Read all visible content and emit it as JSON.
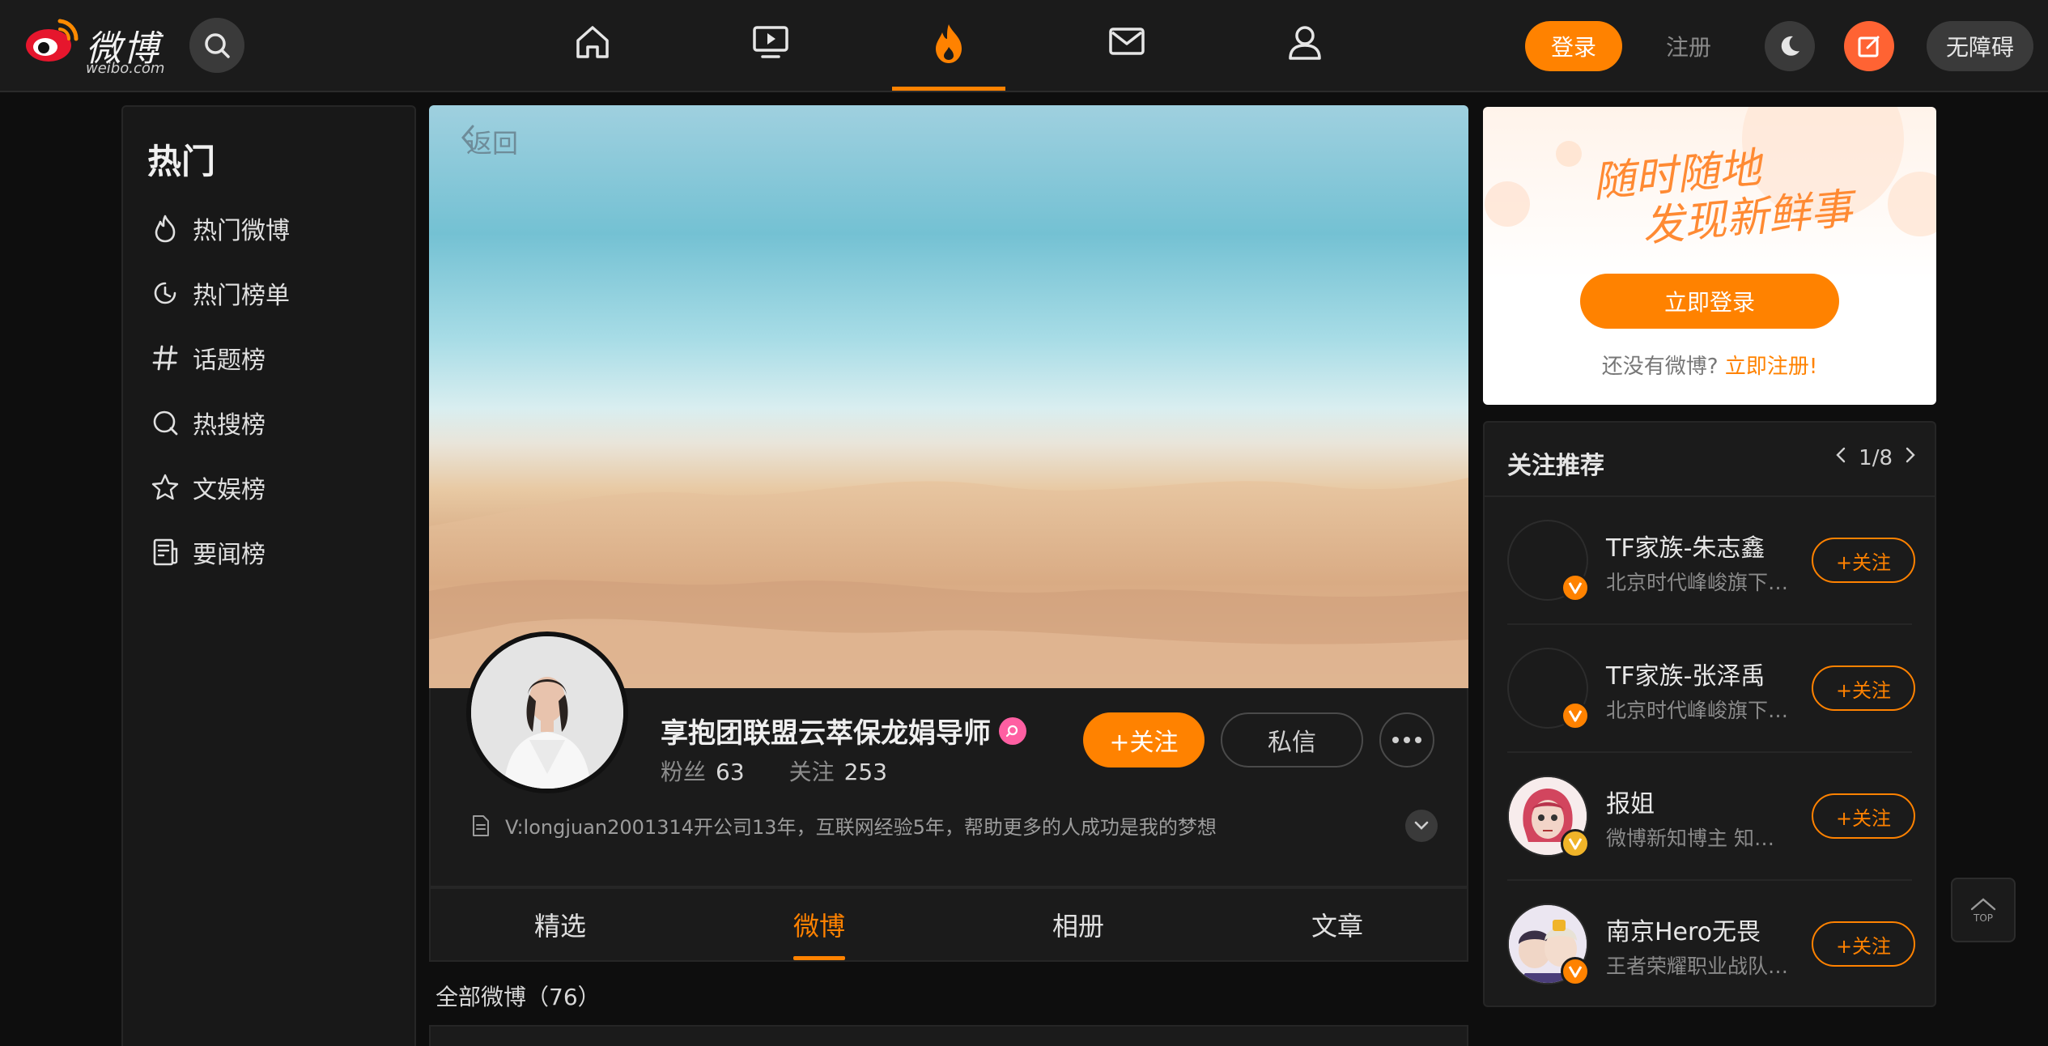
{
  "header": {
    "logo_text": "微博",
    "logo_sub": "weibo.com",
    "login_label": "登录",
    "register_label": "注册",
    "accessibility_label": "无障碍",
    "nav": [
      {
        "icon": "home-icon"
      },
      {
        "icon": "video-icon"
      },
      {
        "icon": "hot-flame-icon",
        "active": true
      },
      {
        "icon": "mail-icon"
      },
      {
        "icon": "user-icon"
      }
    ],
    "accent": "#ff8200"
  },
  "sidebar": {
    "title": "热门",
    "items": [
      {
        "label": "热门微博",
        "icon": "flame-icon"
      },
      {
        "label": "热门榜单",
        "icon": "clock-icon"
      },
      {
        "label": "话题榜",
        "icon": "hash-icon"
      },
      {
        "label": "热搜榜",
        "icon": "search-icon"
      },
      {
        "label": "文娱榜",
        "icon": "star-icon"
      },
      {
        "label": "要闻榜",
        "icon": "news-icon"
      }
    ]
  },
  "profile": {
    "back_label": "返回",
    "name": "享抱团联盟云萃保龙娟导师",
    "fans_label": "粉丝",
    "fans": "63",
    "following_label": "关注",
    "following": "253",
    "follow_label": "+关注",
    "message_label": "私信",
    "bio": "V:longjuan2001314开公司13年，互联网经验5年，帮助更多的人成功是我的梦想"
  },
  "tabs": [
    {
      "label": "精选"
    },
    {
      "label": "微博",
      "active": true
    },
    {
      "label": "相册"
    },
    {
      "label": "文章"
    }
  ],
  "feed": {
    "all_label": "全部微博（76）"
  },
  "login_card": {
    "slogan_line1": "随时随地",
    "slogan_line2": "发现新鲜事",
    "login_now": "立即登录",
    "no_account": "还没有微博?",
    "register_now": "立即注册!"
  },
  "recommend": {
    "title": "关注推荐",
    "page": "1/8",
    "follow_label": "+关注",
    "items": [
      {
        "name": "TF家族-朱志鑫",
        "desc": "北京时代峰峻旗下艺人"
      },
      {
        "name": "TF家族-张泽禹",
        "desc": "北京时代峰峻旗下艺人"
      },
      {
        "name": "报姐",
        "desc": "微博新知博主 知名娱乐博主"
      },
      {
        "name": "南京Hero无畏",
        "desc": "王者荣耀职业战队选手"
      }
    ]
  },
  "back_to_top": "TOP"
}
